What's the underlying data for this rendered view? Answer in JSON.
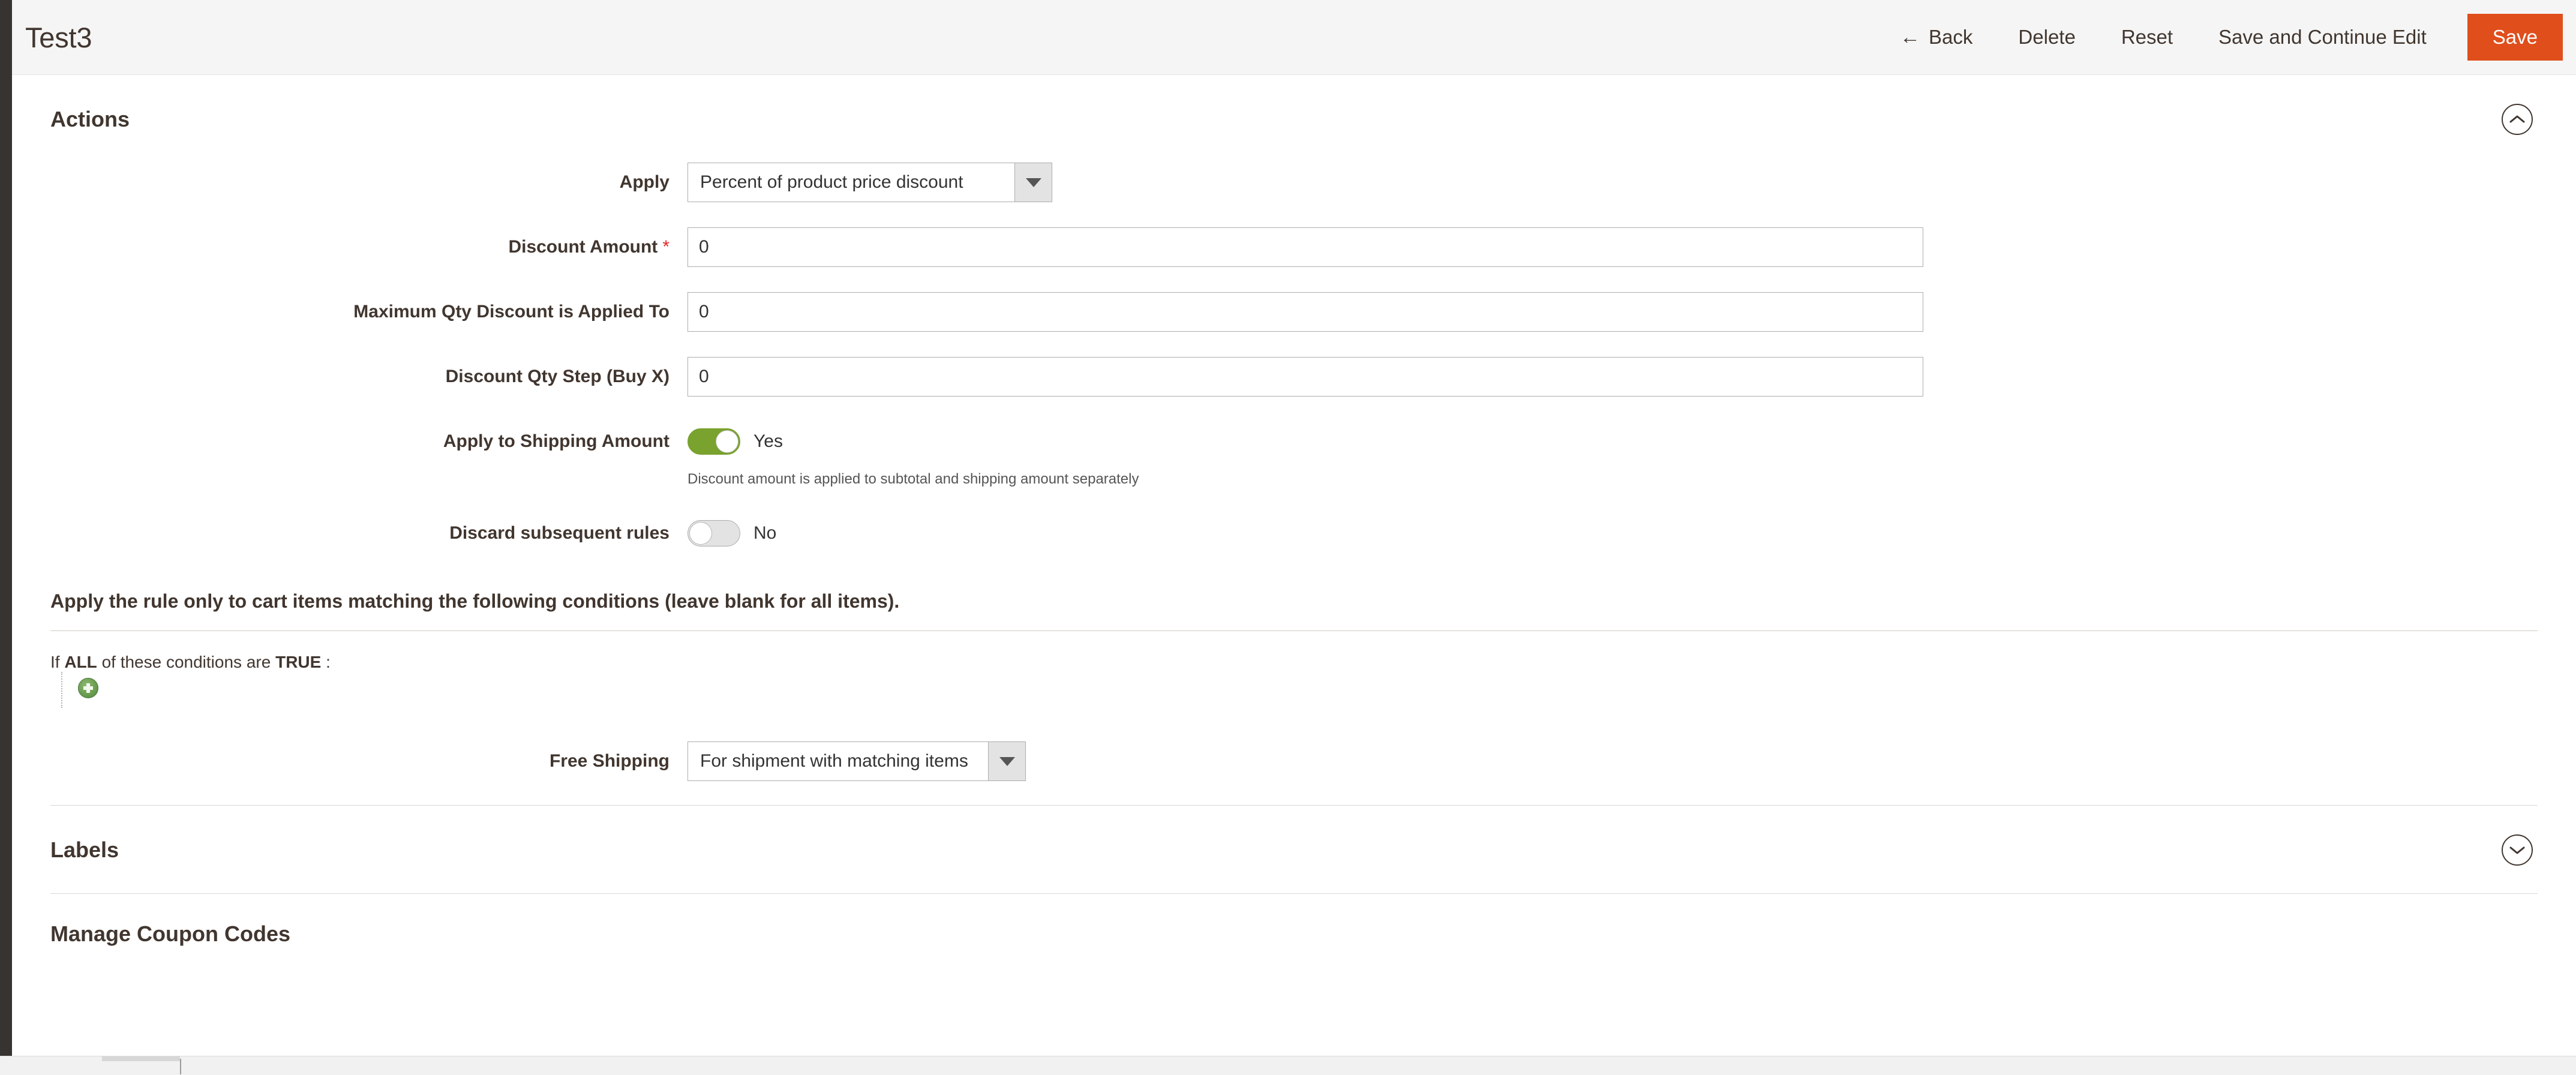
{
  "header": {
    "title": "Test3",
    "back_label": "Back",
    "back_icon": "arrow-left-icon",
    "delete_label": "Delete",
    "reset_label": "Reset",
    "save_continue_label": "Save and Continue Edit",
    "save_label": "Save",
    "save_button_color": "#e04e1c"
  },
  "actions_section": {
    "title": "Actions",
    "collapse_icon": "chevron-up-icon",
    "apply": {
      "label": "Apply",
      "value": "Percent of product price discount",
      "dropdown_icon": "caret-down-icon"
    },
    "discount_amount": {
      "label": "Discount Amount",
      "required_marker": "*",
      "value": "0"
    },
    "max_qty": {
      "label": "Maximum Qty Discount is Applied To",
      "value": "0"
    },
    "qty_step": {
      "label": "Discount Qty Step (Buy X)",
      "value": "0"
    },
    "apply_to_shipping": {
      "label": "Apply to Shipping Amount",
      "state": "Yes",
      "note": "Discount amount is applied to subtotal and shipping amount separately",
      "on_color": "#79a22e"
    },
    "discard_subsequent": {
      "label": "Discard subsequent rules",
      "state": "No"
    }
  },
  "conditions_section": {
    "heading": "Apply the rule only to cart items matching the following conditions (leave blank for all items).",
    "logic_prefix": "If",
    "logic_aggregator": "ALL",
    "logic_middle": "of these conditions are",
    "logic_value": "TRUE",
    "logic_suffix": ":",
    "add_condition_icon": "plus-circle-icon",
    "free_shipping": {
      "label": "Free Shipping",
      "value": "For shipment with matching items",
      "dropdown_icon": "caret-down-icon"
    }
  },
  "labels_section": {
    "title": "Labels",
    "collapse_icon": "chevron-down-icon"
  },
  "coupon_section": {
    "title": "Manage Coupon Codes"
  }
}
